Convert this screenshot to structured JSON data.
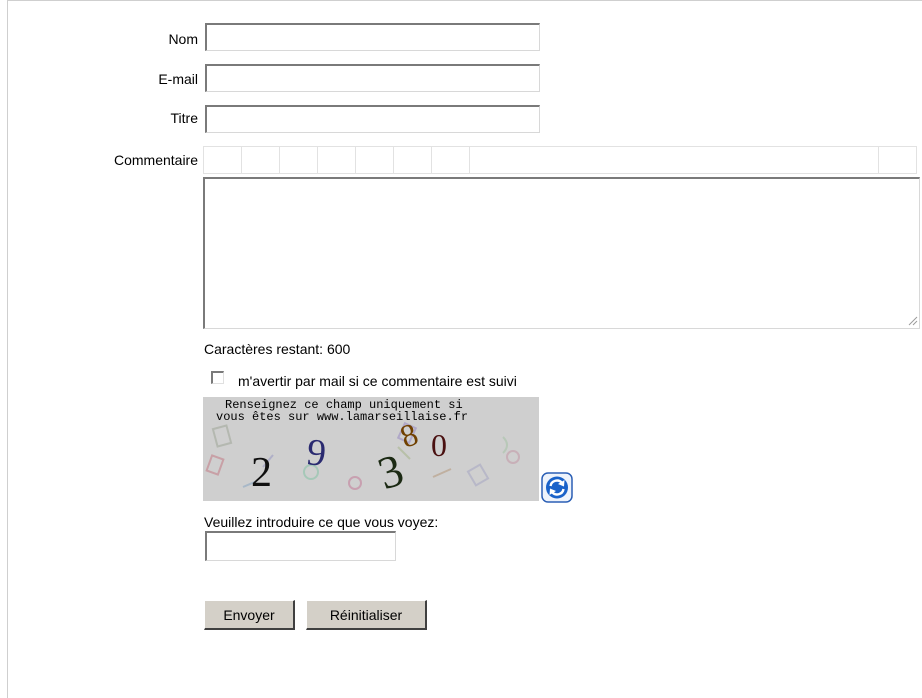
{
  "form": {
    "name_label": "Nom",
    "email_label": "E-mail",
    "title_label": "Titre",
    "comment_label": "Commentaire",
    "name_value": "",
    "email_value": "",
    "title_value": "",
    "comment_value": "",
    "chars_remaining": "Caractères restant: 600",
    "notify_label": "m'avertir par mail si ce commentaire est suivi",
    "captcha_line1": "Renseignez ce champ uniquement si",
    "captcha_line2": "vous êtes sur www.lamarseillaise.fr",
    "captcha_chars": [
      "2",
      "9",
      "3",
      "8",
      "0"
    ],
    "captcha_prompt": "Veuillez introduire ce que vous voyez:",
    "captcha_value": "",
    "submit_label": "Envoyer",
    "reset_label": "Réinitialiser"
  },
  "colors": {
    "button_face": "#d4d0c8",
    "captcha_bg": "#cfcfcf",
    "refresh_icon": "#1a62c9"
  },
  "icons": {
    "refresh": "refresh-icon",
    "resize": "resize-grip-icon"
  }
}
